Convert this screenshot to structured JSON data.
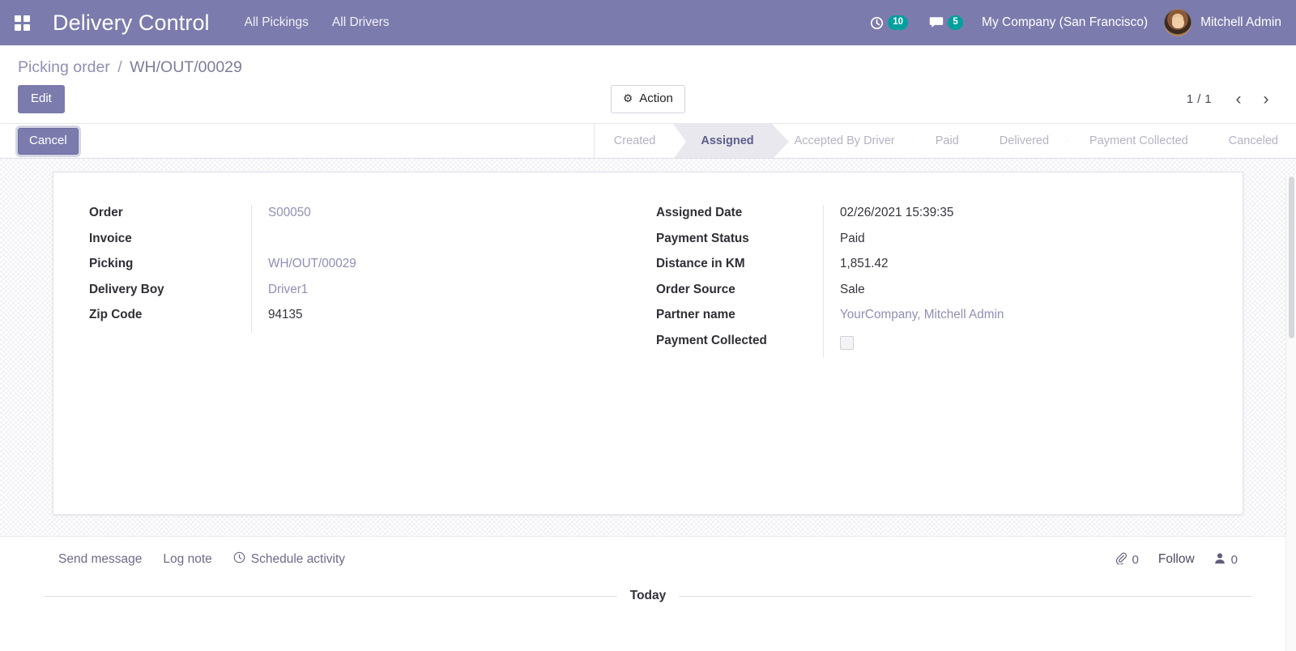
{
  "navbar": {
    "apps_icon": "apps-grid-icon",
    "brand": "Delivery Control",
    "menu": [
      {
        "label": "All Pickings"
      },
      {
        "label": "All Drivers"
      }
    ],
    "activities": {
      "icon": "clock-icon",
      "count": "10"
    },
    "messages": {
      "icon": "chat-bubble-icon",
      "count": "5"
    },
    "company": "My Company (San Francisco)",
    "user": "Mitchell Admin",
    "accent_color": "#7C7BAD",
    "badge_color": "#00A09D"
  },
  "breadcrumb": {
    "root": "Picking order",
    "separator": "/",
    "current": "WH/OUT/00029"
  },
  "control_panel": {
    "edit_label": "Edit",
    "action_label": "Action",
    "action_icon": "gear-icon",
    "pager_text": "1 / 1",
    "prev_icon": "chevron-left-icon",
    "next_icon": "chevron-right-icon"
  },
  "statusbar": {
    "cancel_label": "Cancel",
    "stages": [
      {
        "label": "Created",
        "active": false
      },
      {
        "label": "Assigned",
        "active": true
      },
      {
        "label": "Accepted By Driver",
        "active": false
      },
      {
        "label": "Paid",
        "active": false
      },
      {
        "label": "Delivered",
        "active": false
      },
      {
        "label": "Payment Collected",
        "active": false
      },
      {
        "label": "Canceled",
        "active": false
      }
    ]
  },
  "form": {
    "left": [
      {
        "label": "Order",
        "value": "S00050",
        "kind": "link"
      },
      {
        "label": "Invoice",
        "value": "",
        "kind": "text"
      },
      {
        "label": "Picking",
        "value": "WH/OUT/00029",
        "kind": "link"
      },
      {
        "label": "Delivery Boy",
        "value": "Driver1",
        "kind": "link"
      },
      {
        "label": "Zip Code",
        "value": "94135",
        "kind": "text"
      }
    ],
    "right": [
      {
        "label": "Assigned Date",
        "value": "02/26/2021 15:39:35",
        "kind": "text"
      },
      {
        "label": "Payment Status",
        "value": "Paid",
        "kind": "text"
      },
      {
        "label": "Distance in KM",
        "value": "1,851.42",
        "kind": "text"
      },
      {
        "label": "Order Source",
        "value": "Sale",
        "kind": "text"
      },
      {
        "label": "Partner name",
        "value": "YourCompany, Mitchell Admin",
        "kind": "link"
      },
      {
        "label": "Payment Collected",
        "value": "",
        "kind": "checkbox",
        "checked": false
      }
    ]
  },
  "chatter": {
    "send_message": "Send message",
    "log_note": "Log note",
    "schedule_activity": "Schedule activity",
    "schedule_icon": "clock-icon",
    "attachment_icon": "paperclip-icon",
    "attachment_count": "0",
    "follow_label": "Follow",
    "followers_icon": "user-icon",
    "followers_count": "0",
    "day_separator": "Today"
  }
}
